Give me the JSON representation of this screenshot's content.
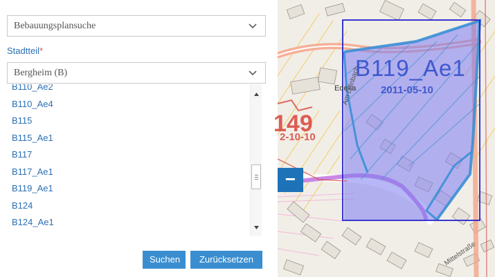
{
  "search_form": {
    "plan_type": {
      "value": "Bebauungsplansuche"
    },
    "district": {
      "label": "Stadtteil",
      "required_marker": "*",
      "value": "Bergheim (B)"
    },
    "plan_list": {
      "items": [
        "B110_Ae2",
        "B110_Ae4",
        "B115",
        "B115_Ae1",
        "B117",
        "B117_Ae1",
        "B119_Ae1",
        "B124",
        "B124_Ae1"
      ]
    },
    "buttons": {
      "search": "Suchen",
      "reset": "Zurücksetzen"
    }
  },
  "map": {
    "zoom_out_label": "−",
    "labels": {
      "plan_code": "B119_Ae1",
      "plan_date": "2011-05-10",
      "other_code": "149",
      "other_date": "2-10-10",
      "poi": "Edeka",
      "street_1": "Am Leinbach",
      "street_2": "Mittelstraße"
    },
    "colors": {
      "highlight_fill": "#7b7bf0",
      "highlight_border": "#2222cc",
      "plan_outline": "#3b8fd6",
      "road": "#f4a58a",
      "route": "#c173e0"
    }
  },
  "theme": {
    "accent": "#3a8ed0",
    "link": "#2a6fb3",
    "required": "#d9534f"
  }
}
